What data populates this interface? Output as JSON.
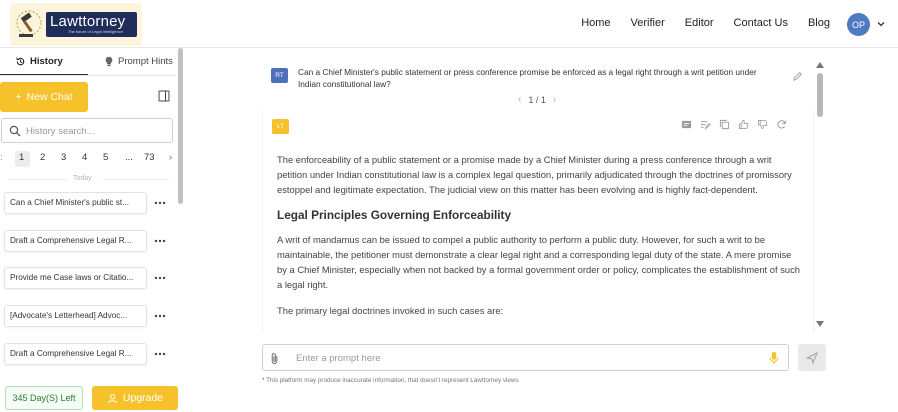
{
  "brand": {
    "name": "Lawttorney",
    "tagline": "The future of Legal Intelligence"
  },
  "nav": {
    "items": [
      "Home",
      "Verifier",
      "Editor",
      "Contact Us",
      "Blog"
    ],
    "avatar_initials": "OP"
  },
  "sidebar": {
    "tabs": {
      "history": "History",
      "prompt_hints": "Prompt Hints"
    },
    "new_chat": "New Chat",
    "search_placeholder": "History search...",
    "pagination": [
      "1",
      "2",
      "3",
      "4",
      "5",
      "...",
      "73"
    ],
    "today_label": "Today",
    "history": [
      "Can a Chief Minister's public st...",
      "Draft a Comprehensive Legal R...",
      "Provide me Case laws or Citatio...",
      "[Advocate's Letterhead] Advoc...",
      "Draft a Comprehensive Legal R..."
    ],
    "days_left": "345 Day(S) Left",
    "upgrade": "Upgrade"
  },
  "chat": {
    "question": {
      "avatar": "RT",
      "text": "Can a Chief Minister's public statement or press conference promise be enforced as a legal right through a writ petition under Indian constitutional law?",
      "pager": "1 / 1"
    },
    "answer": {
      "avatar": "LT",
      "p1": "The enforceability of a public statement or a promise made by a Chief Minister during a press conference through a writ petition under Indian constitutional law is a complex legal question, primarily adjudicated through the doctrines of promissory estoppel and legitimate expectation. The judicial view on this matter has been evolving and is highly fact-dependent.",
      "heading": "Legal Principles Governing Enforceability",
      "p2": "A writ of mandamus can be issued to compel a public authority to perform a public duty. However, for such a writ to be maintainable, the petitioner must demonstrate a clear legal right and a corresponding legal duty of the state. A mere promise by a Chief Minister, especially when not backed by a formal government order or policy, complicates the establishment of such a legal right.",
      "p3": "The primary legal doctrines invoked in such cases are:"
    }
  },
  "prompt": {
    "placeholder": "Enter a prompt here",
    "disclaimer": "This platform may produce inaccurate information, that doesn't represent Lawttorney views"
  },
  "colors": {
    "accent": "#f6c12b",
    "brand_navy": "#1f2d5a",
    "avatar_blue": "#4f79c2"
  }
}
